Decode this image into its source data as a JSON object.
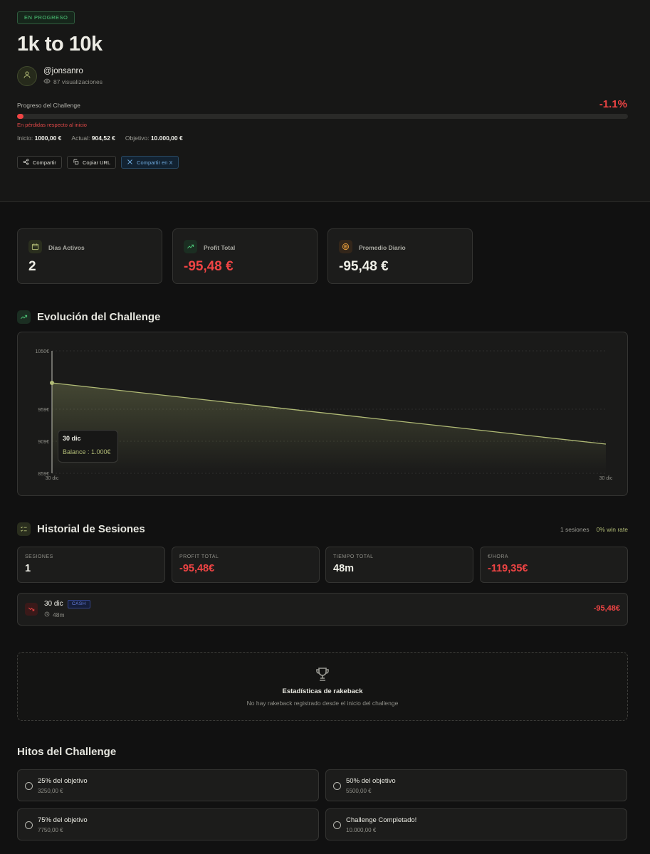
{
  "hero": {
    "badge": "EN PROGRESO",
    "title": "1k to 10k",
    "username": "@jonsanro",
    "views": "87 visualizaciones",
    "progress_label": "Progreso del Challenge",
    "progress_pct_text": "-1.1%",
    "progress_fraction": 0.011,
    "progress_warning": "En pérdidas respecto al inicio",
    "inicio_label": "Inicio:",
    "inicio_value": "1000,00 €",
    "actual_label": "Actual:",
    "actual_value": "904,52 €",
    "objetivo_label": "Objetivo:",
    "objetivo_value": "10.000,00 €",
    "buttons": {
      "share": "Compartir",
      "copy_url": "Copiar URL",
      "share_x": "Compartir en X"
    }
  },
  "stats": [
    {
      "label": "Días Activos",
      "value": "2",
      "icon": "calendar-icon"
    },
    {
      "label": "Profit Total",
      "value": "-95,48 €",
      "icon": "trending-up-icon"
    },
    {
      "label": "Promedio Diario",
      "value": "-95,48 €",
      "icon": "target-icon"
    }
  ],
  "evolution": {
    "title": "Evolución del Challenge",
    "tooltip": {
      "date": "30 dic",
      "balance": "Balance : 1.000€"
    }
  },
  "chart_data": {
    "type": "area",
    "x": [
      "30 dic",
      "30 dic"
    ],
    "values": [
      1000,
      904.52
    ],
    "yticks": [
      "1050€",
      "959€",
      "909€",
      "859€"
    ],
    "ytick_values": [
      1050,
      959,
      909,
      859
    ],
    "ylim": [
      859,
      1050
    ],
    "xlabel": "",
    "ylabel": "",
    "grid": true,
    "color": "#b1bb76"
  },
  "history": {
    "title": "Historial de Sesiones",
    "sessions_count_text": "1 sesiones",
    "win_rate_text": "0% win rate",
    "summary": [
      {
        "label": "SESIONES",
        "value": "1"
      },
      {
        "label": "PROFIT TOTAL",
        "value": "-95,48€"
      },
      {
        "label": "TIEMPO TOTAL",
        "value": "48m"
      },
      {
        "label": "€/HORA",
        "value": "-119,35€"
      }
    ],
    "session": {
      "date": "30 dic",
      "tag": "CASH",
      "duration": "48m",
      "profit": "-95,48€"
    }
  },
  "rakeback": {
    "title": "Estadísticas de rakeback",
    "subtitle": "No hay rakeback registrado desde el inicio del challenge"
  },
  "milestones": {
    "title": "Hitos del Challenge",
    "items": [
      {
        "name": "25% del objetivo",
        "amount": "3250,00 €"
      },
      {
        "name": "50% del objetivo",
        "amount": "5500,00 €"
      },
      {
        "name": "75% del objetivo",
        "amount": "7750,00 €"
      },
      {
        "name": "Challenge Completado!",
        "amount": "10.000,00 €"
      }
    ]
  },
  "colors": {
    "accent": "#b1bb76",
    "loss": "#ef4444",
    "success": "#4ec879"
  }
}
